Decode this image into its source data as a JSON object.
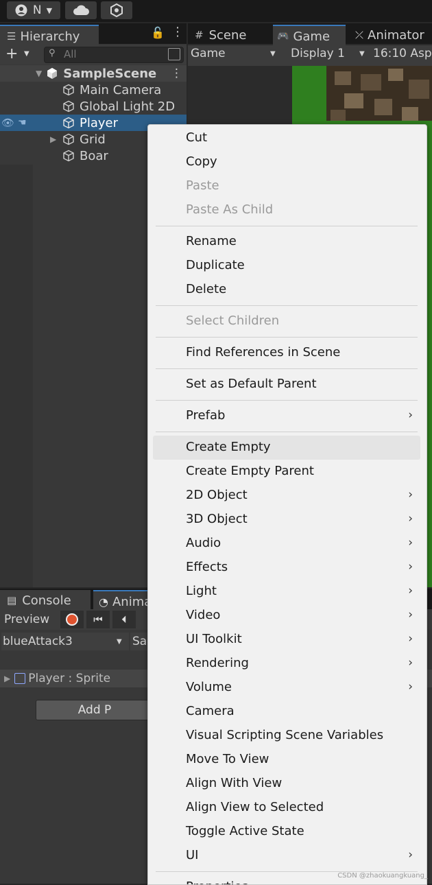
{
  "toolbar": {
    "account_label": "N"
  },
  "hierarchy": {
    "tab_label": "Hierarchy",
    "search_placeholder": "All",
    "scene_name": "SampleScene",
    "items": [
      {
        "label": "Main Camera"
      },
      {
        "label": "Global Light 2D"
      },
      {
        "label": "Player"
      },
      {
        "label": "Grid"
      },
      {
        "label": "Boar"
      }
    ]
  },
  "view_tabs": {
    "scene": "Scene",
    "game": "Game",
    "animator": "Animator"
  },
  "game_bar": {
    "mode": "Game",
    "display": "Display 1",
    "aspect": "16:10 Asp"
  },
  "bottom": {
    "console_tab": "Console",
    "anim_tab": "Anima",
    "preview_label": "Preview",
    "clip_name": "blueAttack3",
    "sample_label": "Sa",
    "property": "Player : Sprite",
    "add_button": "Add P"
  },
  "menu": {
    "items": [
      {
        "label": "Cut",
        "enabled": true
      },
      {
        "label": "Copy",
        "enabled": true
      },
      {
        "label": "Paste",
        "enabled": false
      },
      {
        "label": "Paste As Child",
        "enabled": false
      },
      {
        "label": "Rename",
        "enabled": true
      },
      {
        "label": "Duplicate",
        "enabled": true
      },
      {
        "label": "Delete",
        "enabled": true
      },
      {
        "label": "Select Children",
        "enabled": false
      },
      {
        "label": "Find References in Scene",
        "enabled": true
      },
      {
        "label": "Set as Default Parent",
        "enabled": true
      },
      {
        "label": "Prefab",
        "enabled": true,
        "submenu": true
      },
      {
        "label": "Create Empty",
        "enabled": true,
        "highlighted": true
      },
      {
        "label": "Create Empty Parent",
        "enabled": true
      },
      {
        "label": "2D Object",
        "enabled": true,
        "submenu": true
      },
      {
        "label": "3D Object",
        "enabled": true,
        "submenu": true
      },
      {
        "label": "Audio",
        "enabled": true,
        "submenu": true
      },
      {
        "label": "Effects",
        "enabled": true,
        "submenu": true
      },
      {
        "label": "Light",
        "enabled": true,
        "submenu": true
      },
      {
        "label": "Video",
        "enabled": true,
        "submenu": true
      },
      {
        "label": "UI Toolkit",
        "enabled": true,
        "submenu": true
      },
      {
        "label": "Rendering",
        "enabled": true,
        "submenu": true
      },
      {
        "label": "Volume",
        "enabled": true,
        "submenu": true
      },
      {
        "label": "Camera",
        "enabled": true
      },
      {
        "label": "Visual Scripting Scene Variables",
        "enabled": true
      },
      {
        "label": "Move To View",
        "enabled": true
      },
      {
        "label": "Align With View",
        "enabled": true
      },
      {
        "label": "Align View to Selected",
        "enabled": true
      },
      {
        "label": "Toggle Active State",
        "enabled": true
      },
      {
        "label": "UI",
        "enabled": true,
        "submenu": true
      },
      {
        "label": "Properties...",
        "enabled": true
      }
    ]
  },
  "watermark": "CSDN @zhaokuangkuang_",
  "colors": {
    "selection": "#2c5d87",
    "menu_bg": "#f1f1f1",
    "accent": "#3a79bb",
    "record": "#e0532f",
    "game_green": "#2f7f1f"
  }
}
